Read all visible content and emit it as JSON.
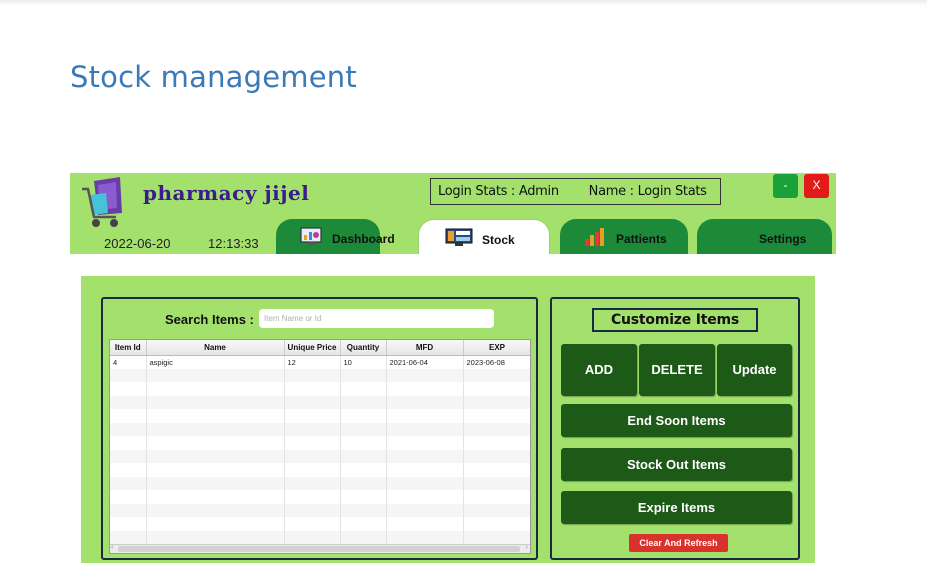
{
  "page": {
    "title": "Stock management"
  },
  "app": {
    "name": "pharmacy jijel",
    "date": "2022-06-20",
    "time": "12:13:33",
    "login": {
      "stats_label": "Login Stats :",
      "user": "Admin",
      "name_label": "Name :",
      "name_value": "Login Stats"
    },
    "window_buttons": {
      "minimize": "-",
      "close": "X"
    },
    "tabs": [
      {
        "label": "Dashboard",
        "icon": "dashboard-icon"
      },
      {
        "label": "Stock",
        "icon": "stock-monitor-icon",
        "active": true
      },
      {
        "label": "Pattients",
        "icon": "bar-chart-icon"
      },
      {
        "label": "Settings"
      }
    ],
    "colors": {
      "background": "#a4e16c",
      "button": "#1d5a17",
      "clear_button": "#d9312b",
      "title": "#3a7ab8"
    }
  },
  "search": {
    "label": "Search Items :",
    "placeholder": "Item Name or Id"
  },
  "table": {
    "columns": [
      "Item Id",
      "Name",
      "Unique Price",
      "Quantity",
      "MFD",
      "EXP"
    ],
    "rows": [
      [
        "4",
        "aspigic",
        "12",
        "10",
        "2021-06-04",
        "2023-06-08"
      ]
    ]
  },
  "customize": {
    "title": "Customize Items",
    "add": "ADD",
    "delete": "DELETE",
    "update": "Update",
    "end_soon": "End Soon Items",
    "stock_out": "Stock Out Items",
    "expire": "Expire Items",
    "clear": "Clear And Refresh"
  }
}
